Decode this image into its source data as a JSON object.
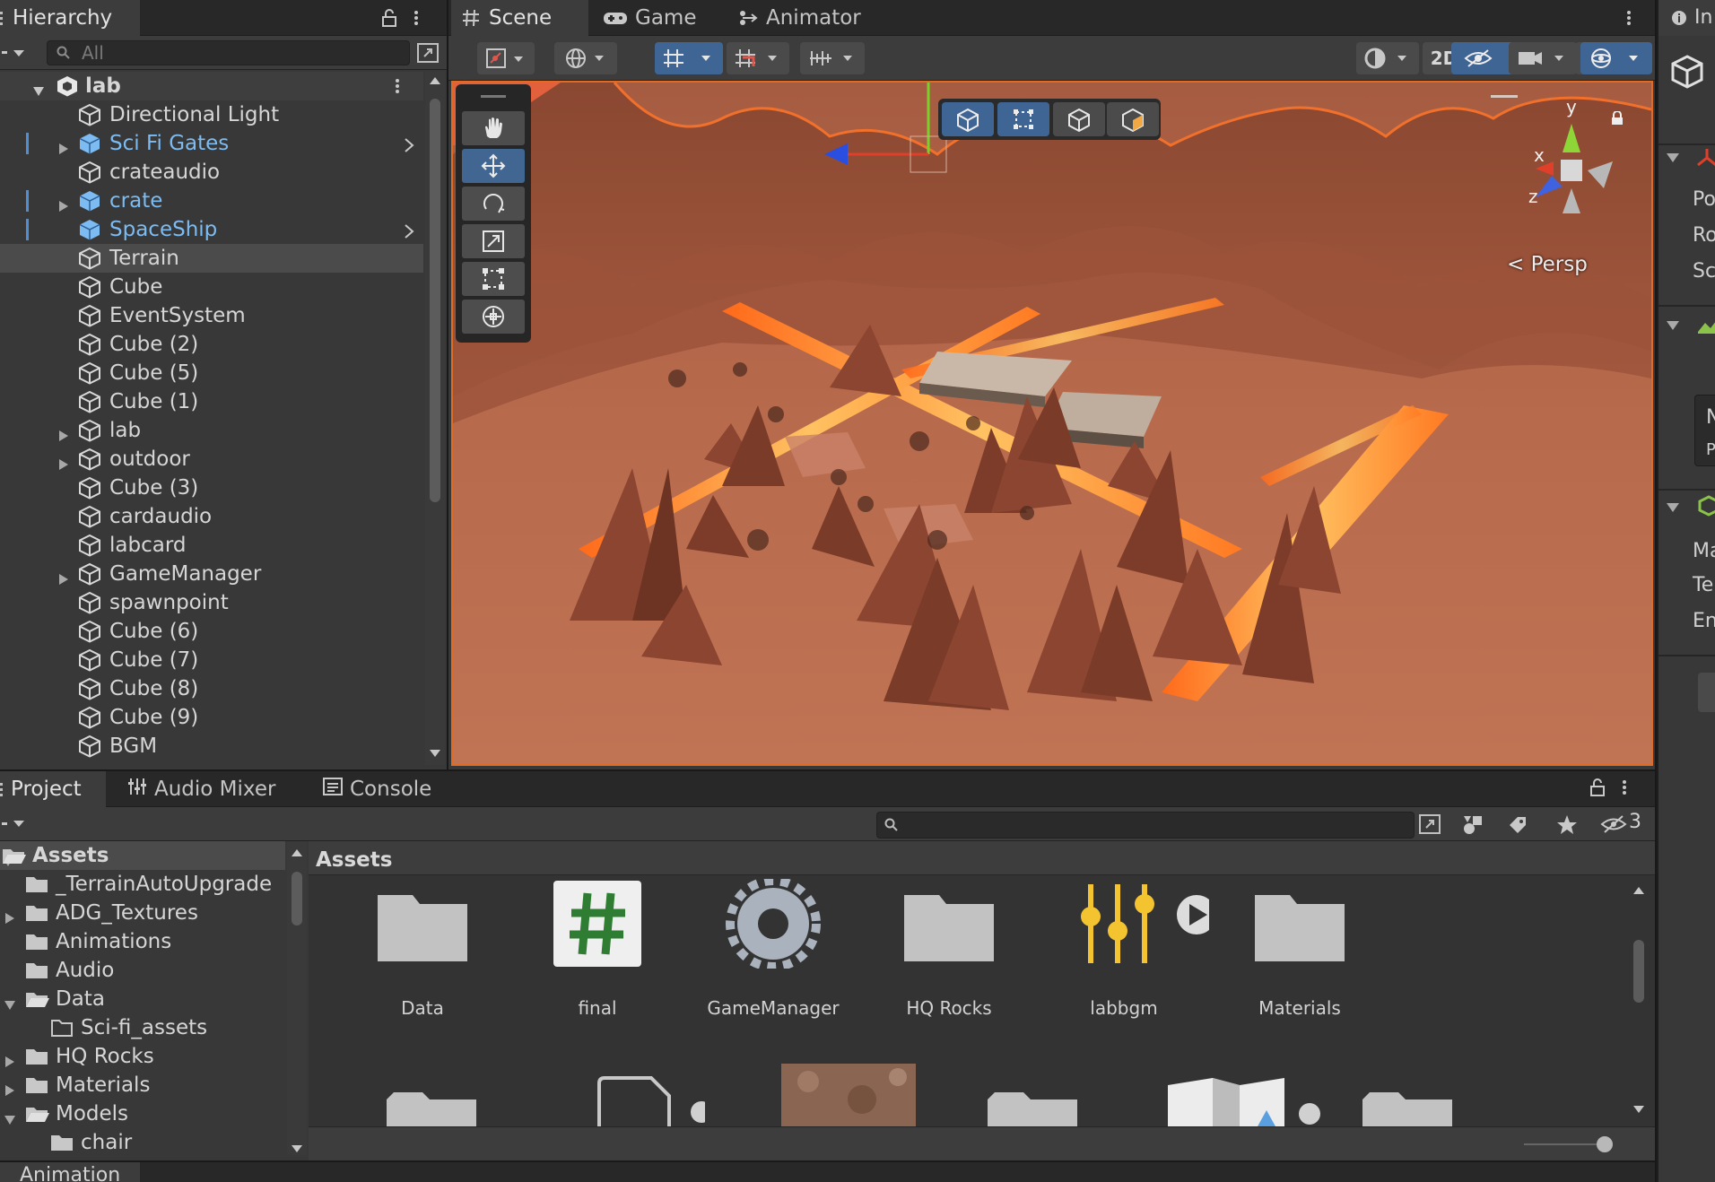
{
  "hierarchy": {
    "tab": "Hierarchy",
    "search_placeholder": "All",
    "scene_name": "lab",
    "items": [
      {
        "label": "Directional Light",
        "prefab": false,
        "expandable": false
      },
      {
        "label": "Sci Fi Gates",
        "prefab": true,
        "expandable": true
      },
      {
        "label": "crateaudio",
        "prefab": false,
        "expandable": false
      },
      {
        "label": "crate",
        "prefab": true,
        "expandable": true
      },
      {
        "label": "SpaceShip",
        "prefab": true,
        "expandable": false
      },
      {
        "label": "Terrain",
        "prefab": false,
        "expandable": false
      },
      {
        "label": "Cube",
        "prefab": false,
        "expandable": false
      },
      {
        "label": "EventSystem",
        "prefab": false,
        "expandable": false
      },
      {
        "label": "Cube (2)",
        "prefab": false,
        "expandable": false
      },
      {
        "label": "Cube (5)",
        "prefab": false,
        "expandable": false
      },
      {
        "label": "Cube (1)",
        "prefab": false,
        "expandable": false
      },
      {
        "label": "lab",
        "prefab": false,
        "expandable": true
      },
      {
        "label": "outdoor",
        "prefab": false,
        "expandable": true
      },
      {
        "label": "Cube (3)",
        "prefab": false,
        "expandable": false
      },
      {
        "label": "cardaudio",
        "prefab": false,
        "expandable": false
      },
      {
        "label": "labcard",
        "prefab": false,
        "expandable": false
      },
      {
        "label": "GameManager",
        "prefab": false,
        "expandable": true
      },
      {
        "label": "spawnpoint",
        "prefab": false,
        "expandable": false
      },
      {
        "label": "Cube (6)",
        "prefab": false,
        "expandable": false
      },
      {
        "label": "Cube (7)",
        "prefab": false,
        "expandable": false
      },
      {
        "label": "Cube (8)",
        "prefab": false,
        "expandable": false
      },
      {
        "label": "Cube (9)",
        "prefab": false,
        "expandable": false
      },
      {
        "label": "BGM",
        "prefab": false,
        "expandable": false
      }
    ],
    "selected": "Terrain"
  },
  "scene": {
    "tabs": [
      "Scene",
      "Game",
      "Animator"
    ],
    "active_tab": "Scene",
    "toolbar_2d": "2D",
    "hidden_count": "3",
    "persp_label": "Persp",
    "gizmo_axes": {
      "x": "x",
      "y": "y",
      "z": "z"
    }
  },
  "inspector": {
    "tab": "In",
    "rows": [
      "Po",
      "Ro",
      "Sc",
      "N",
      "Pl",
      "Ma",
      "Te",
      "En"
    ]
  },
  "project": {
    "tabs": [
      "Project",
      "Audio Mixer",
      "Console"
    ],
    "active_tab": "Project",
    "breadcrumb": "Assets",
    "hidden_packages": "3",
    "tree": [
      {
        "label": "Assets",
        "depth": 0,
        "state": "open",
        "selected": true
      },
      {
        "label": "_TerrainAutoUpgrade",
        "depth": 1,
        "state": "leaf"
      },
      {
        "label": "ADG_Textures",
        "depth": 1,
        "state": "closed"
      },
      {
        "label": "Animations",
        "depth": 1,
        "state": "leaf"
      },
      {
        "label": "Audio",
        "depth": 1,
        "state": "leaf"
      },
      {
        "label": "Data",
        "depth": 1,
        "state": "open"
      },
      {
        "label": "Sci-fi_assets",
        "depth": 2,
        "state": "empty"
      },
      {
        "label": "HQ Rocks",
        "depth": 1,
        "state": "closed"
      },
      {
        "label": "Materials",
        "depth": 1,
        "state": "closed"
      },
      {
        "label": "Models",
        "depth": 1,
        "state": "open"
      },
      {
        "label": "chair",
        "depth": 2,
        "state": "leaf"
      }
    ],
    "assets": [
      {
        "label": "Data",
        "icon": "folder-icon"
      },
      {
        "label": "final",
        "icon": "csharp-script-icon"
      },
      {
        "label": "GameManager",
        "icon": "gear-icon"
      },
      {
        "label": "HQ Rocks",
        "icon": "folder-icon"
      },
      {
        "label": "labbgm",
        "icon": "audio-mixer-icon"
      },
      {
        "label": "Materials",
        "icon": "folder-icon"
      }
    ]
  },
  "animation_tab": "Animation",
  "colors": {
    "accent": "#3f6594",
    "prefab_text": "#7cbcf2",
    "scene_border": "#e06b24"
  }
}
